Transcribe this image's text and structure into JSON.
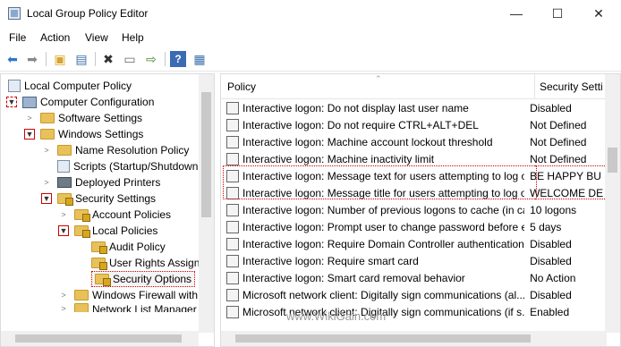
{
  "window": {
    "title": "Local Group Policy Editor",
    "controls": {
      "minimize": "—",
      "maximize": "☐",
      "close": "✕"
    }
  },
  "menu": [
    "File",
    "Action",
    "View",
    "Help"
  ],
  "toolbar": [
    "back-arrow-icon",
    "forward-arrow-icon",
    "up-folder-icon",
    "show-hide-tree-icon",
    "delete-icon",
    "properties-icon",
    "export-list-icon",
    "help-icon",
    "toggle-view-icon"
  ],
  "tree": {
    "root": "Local Computer Policy",
    "computer_config": "Computer Configuration",
    "software_settings": "Software Settings",
    "windows_settings": "Windows Settings",
    "name_resolution": "Name Resolution Policy",
    "scripts": "Scripts (Startup/Shutdown",
    "deployed_printers": "Deployed Printers",
    "security_settings": "Security Settings",
    "account_policies": "Account Policies",
    "local_policies": "Local Policies",
    "audit_policy": "Audit Policy",
    "user_rights": "User Rights Assignm",
    "security_options": "Security Options",
    "windows_firewall": "Windows Firewall with",
    "network_list": "Network List Manager"
  },
  "list": {
    "col_policy": "Policy",
    "col_setting": "Security Setti",
    "rows": [
      {
        "name": "Interactive logon: Do not display last user name",
        "setting": "Disabled"
      },
      {
        "name": "Interactive logon: Do not require CTRL+ALT+DEL",
        "setting": "Not Defined"
      },
      {
        "name": "Interactive logon: Machine account lockout threshold",
        "setting": "Not Defined"
      },
      {
        "name": "Interactive logon: Machine inactivity limit",
        "setting": "Not Defined"
      },
      {
        "name": "Interactive logon: Message text for users attempting to log on",
        "setting": "BE HAPPY BU"
      },
      {
        "name": "Interactive logon: Message title for users attempting to log on",
        "setting": "WELCOME DE"
      },
      {
        "name": "Interactive logon: Number of previous logons to cache (in cas...",
        "setting": "10 logons"
      },
      {
        "name": "Interactive logon: Prompt user to change password before e...",
        "setting": "5 days"
      },
      {
        "name": "Interactive logon: Require Domain Controller authentication...",
        "setting": "Disabled"
      },
      {
        "name": "Interactive logon: Require smart card",
        "setting": "Disabled"
      },
      {
        "name": "Interactive logon: Smart card removal behavior",
        "setting": "No Action"
      },
      {
        "name": "Microsoft network client: Digitally sign communications (al...",
        "setting": "Disabled"
      },
      {
        "name": "Microsoft network client: Digitally sign communications (if s...",
        "setting": "Enabled"
      }
    ]
  },
  "watermark": "www.WikiGain.com"
}
